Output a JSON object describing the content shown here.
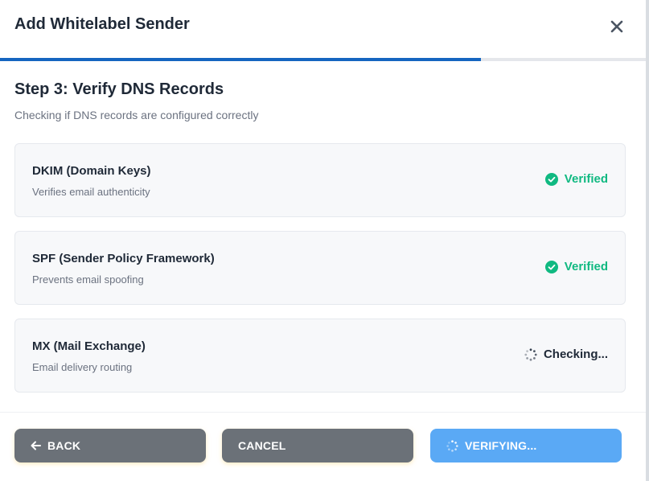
{
  "dialog": {
    "title": "Add Whitelabel Sender",
    "close_icon": "close-icon",
    "progress": 0.745,
    "progress_color": "#1565c0"
  },
  "step": {
    "title": "Step 3: Verify DNS Records",
    "subtitle": "Checking if DNS records are configured correctly"
  },
  "records": [
    {
      "name": "DKIM (Domain Keys)",
      "description": "Verifies email authenticity",
      "status": "Verified",
      "state": "verified",
      "icon": "check-circle-icon"
    },
    {
      "name": "SPF (Sender Policy Framework)",
      "description": "Prevents email spoofing",
      "status": "Verified",
      "state": "verified",
      "icon": "check-circle-icon"
    },
    {
      "name": "MX (Mail Exchange)",
      "description": "Email delivery routing",
      "status": "Checking...",
      "state": "checking",
      "icon": "spinner-icon"
    }
  ],
  "footer": {
    "back_label": "BACK",
    "back_icon": "arrow-left-icon",
    "cancel_label": "CANCEL",
    "verify_label": "VERIFYING...",
    "verify_icon": "spinner-icon"
  },
  "colors": {
    "verified": "#10b981",
    "button_gray": "#6b7178",
    "button_blue": "#5aa9f5"
  }
}
